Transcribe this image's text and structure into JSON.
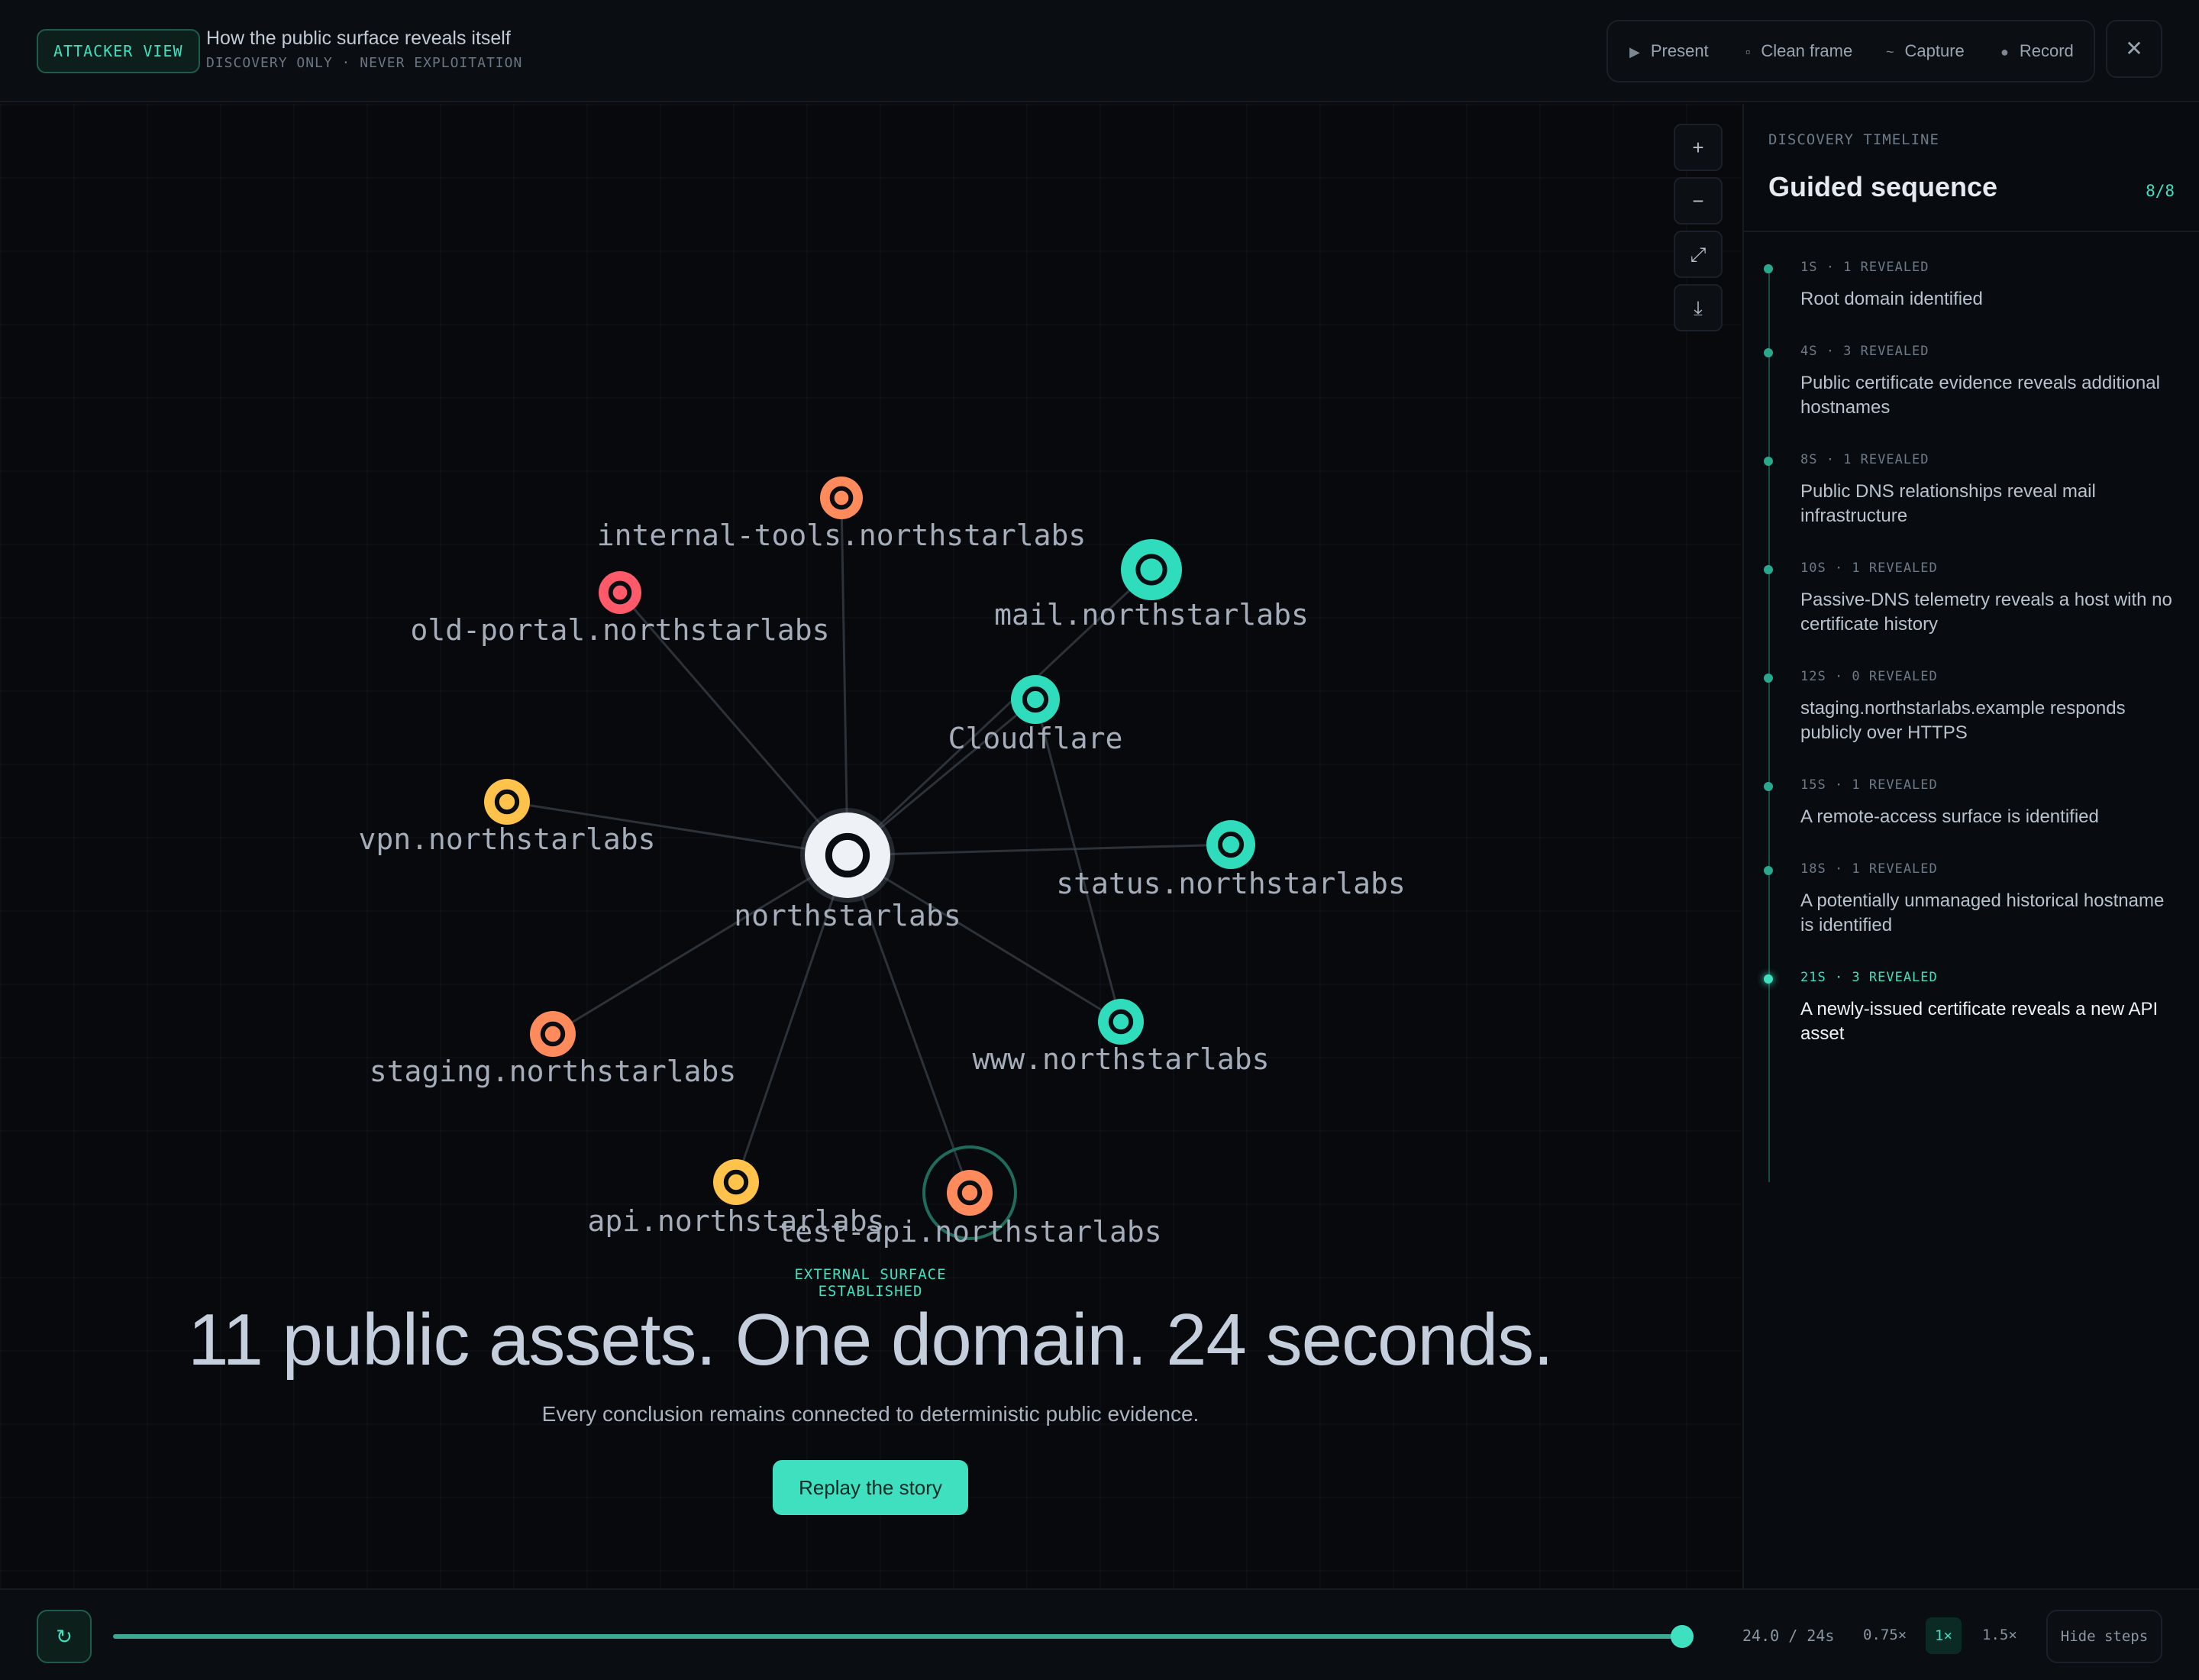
{
  "header": {
    "badge": "ATTACKER VIEW",
    "title": "How the public surface reveals itself",
    "subtitle": "DISCOVERY ONLY · NEVER EXPLOITATION",
    "controls": [
      {
        "icon": "play-icon",
        "glyph": "▶",
        "label": "Present"
      },
      {
        "icon": "frame-icon",
        "glyph": "▫",
        "label": "Clean frame"
      },
      {
        "icon": "capture-icon",
        "glyph": "~",
        "label": "Capture"
      },
      {
        "icon": "record-icon",
        "glyph": "●",
        "label": "Record"
      }
    ],
    "close_glyph": "✕"
  },
  "zoom_controls": [
    {
      "name": "zoom-in-button",
      "glyph": "+"
    },
    {
      "name": "zoom-out-button",
      "glyph": "−"
    },
    {
      "name": "fit-view-button",
      "glyph": "⤢"
    },
    {
      "name": "download-button",
      "glyph": "⤓"
    }
  ],
  "graph": {
    "colors": {
      "teal": "#2fdcbc",
      "orange": "#ff8a5b",
      "red": "#ff5a6a",
      "yellow": "#ffc24a",
      "root": "#eef1f6",
      "edge": "#3a4048"
    },
    "nodes": [
      {
        "id": "root",
        "label": "northstarlabs",
        "color": "root"
      },
      {
        "id": "internal-tools",
        "label": "internal-tools.northstarlabs",
        "color": "orange"
      },
      {
        "id": "old-portal",
        "label": "old-portal.northstarlabs",
        "color": "red"
      },
      {
        "id": "mail",
        "label": "mail.northstarlabs",
        "color": "teal"
      },
      {
        "id": "cloudflare",
        "label": "Cloudflare",
        "color": "teal"
      },
      {
        "id": "vpn",
        "label": "vpn.northstarlabs",
        "color": "yellow"
      },
      {
        "id": "status",
        "label": "status.northstarlabs",
        "color": "teal"
      },
      {
        "id": "staging",
        "label": "staging.northstarlabs",
        "color": "orange"
      },
      {
        "id": "www",
        "label": "www.northstarlabs",
        "color": "teal"
      },
      {
        "id": "api",
        "label": "api.northstarlabs",
        "color": "yellow"
      },
      {
        "id": "test-api",
        "label": "test-api.northstarlabs",
        "color": "orange"
      }
    ],
    "edges": [
      [
        "root",
        "internal-tools"
      ],
      [
        "root",
        "old-portal"
      ],
      [
        "root",
        "mail"
      ],
      [
        "root",
        "cloudflare"
      ],
      [
        "root",
        "vpn"
      ],
      [
        "root",
        "status"
      ],
      [
        "root",
        "staging"
      ],
      [
        "root",
        "www"
      ],
      [
        "root",
        "api"
      ],
      [
        "root",
        "test-api"
      ],
      [
        "cloudflare",
        "www"
      ]
    ],
    "highlighted": "test-api"
  },
  "summary": {
    "established": "EXTERNAL SURFACE ESTABLISHED",
    "headline": "11 public assets. One domain. 24 seconds.",
    "subline": "Every conclusion remains connected to deterministic public evidence.",
    "replay": "Replay the story"
  },
  "sidebar": {
    "kicker": "DISCOVERY TIMELINE",
    "title": "Guided sequence",
    "count": "8/8",
    "steps": [
      {
        "meta": "1S · 1 REVEALED",
        "text": "Root domain identified"
      },
      {
        "meta": "4S · 3 REVEALED",
        "text": "Public certificate evidence reveals additional hostnames"
      },
      {
        "meta": "8S · 1 REVEALED",
        "text": "Public DNS relationships reveal mail infrastructure"
      },
      {
        "meta": "10S · 1 REVEALED",
        "text": "Passive-DNS telemetry reveals a host with no certificate history"
      },
      {
        "meta": "12S · 0 REVEALED",
        "text": "staging.northstarlabs.example responds publicly over HTTPS"
      },
      {
        "meta": "15S · 1 REVEALED",
        "text": "A remote-access surface is identified"
      },
      {
        "meta": "18S · 1 REVEALED",
        "text": "A potentially unmanaged historical hostname is identified"
      },
      {
        "meta": "21S · 3 REVEALED",
        "text": "A newly-issued certificate reveals a new API asset"
      }
    ],
    "active_index": 7
  },
  "playback": {
    "loop_glyph": "↻",
    "progress": 1.0,
    "time": "24.0 / 24s",
    "speeds": [
      "0.75×",
      "1×",
      "1.5×"
    ],
    "active_speed": "1×",
    "hide_steps": "Hide steps"
  }
}
